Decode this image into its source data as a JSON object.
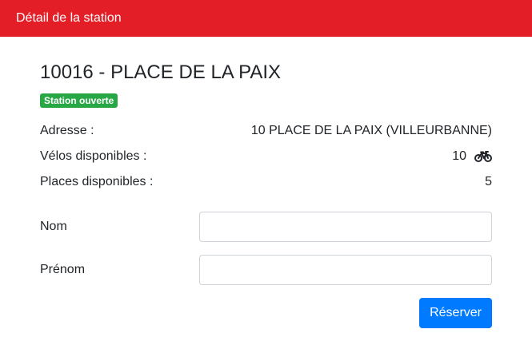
{
  "header": {
    "title": "Détail de la station"
  },
  "station": {
    "title": "10016 - PLACE DE LA PAIX",
    "status_badge": "Station ouverte",
    "status_color": "#28a745"
  },
  "info": {
    "address_label": "Adresse :",
    "address_value": "10 PLACE DE LA PAIX (VILLEURBANNE)",
    "bikes_label": "Vélos disponibles :",
    "bikes_value": "10",
    "bikes_icon": "bicycle-icon",
    "places_label": "Places disponibles :",
    "places_value": "5"
  },
  "form": {
    "nom_label": "Nom",
    "nom_value": "",
    "prenom_label": "Prénom",
    "prenom_value": "",
    "submit_label": "Réserver"
  },
  "colors": {
    "header": "#e31e27",
    "primary": "#007bff"
  }
}
